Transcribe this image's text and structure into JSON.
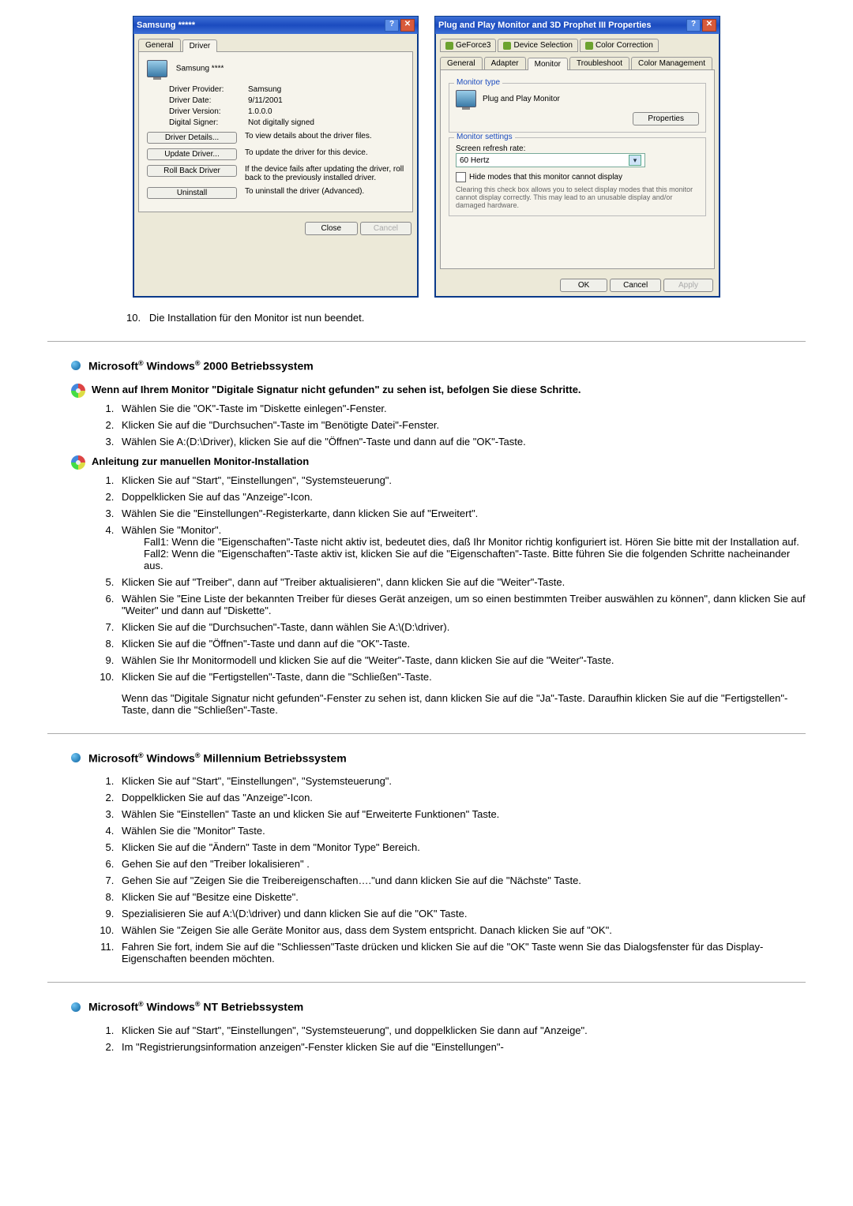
{
  "dialog_left": {
    "title": "Samsung *****",
    "tabs": {
      "general": "General",
      "driver": "Driver"
    },
    "device_name": "Samsung ****",
    "rows": {
      "provider_k": "Driver Provider:",
      "provider_v": "Samsung",
      "date_k": "Driver Date:",
      "date_v": "9/11/2001",
      "version_k": "Driver Version:",
      "version_v": "1.0.0.0",
      "signer_k": "Digital Signer:",
      "signer_v": "Not digitally signed"
    },
    "buttons": {
      "details": "Driver Details...",
      "details_desc": "To view details about the driver files.",
      "update": "Update Driver...",
      "update_desc": "To update the driver for this device.",
      "rollback": "Roll Back Driver",
      "rollback_desc": "If the device fails after updating the driver, roll back to the previously installed driver.",
      "uninstall": "Uninstall",
      "uninstall_desc": "To uninstall the driver (Advanced)."
    },
    "footer": {
      "close": "Close",
      "cancel": "Cancel"
    }
  },
  "dialog_right": {
    "title": "Plug and Play Monitor and 3D Prophet III Properties",
    "tabs_top": {
      "geforce": "GeForce3",
      "devsel": "Device Selection",
      "colorcorr": "Color Correction"
    },
    "tabs_bot": {
      "general": "General",
      "adapter": "Adapter",
      "monitor": "Monitor",
      "troubleshoot": "Troubleshoot",
      "colormgmt": "Color Management"
    },
    "group1": {
      "legend": "Monitor type",
      "name": "Plug and Play Monitor",
      "props": "Properties"
    },
    "group2": {
      "legend": "Monitor settings",
      "refresh_label": "Screen refresh rate:",
      "refresh_value": "60 Hertz",
      "hide_modes": "Hide modes that this monitor cannot display",
      "note": "Clearing this check box allows you to select display modes that this monitor cannot display correctly. This may lead to an unusable display and/or damaged hardware."
    },
    "footer": {
      "ok": "OK",
      "cancel": "Cancel",
      "apply": "Apply"
    }
  },
  "step10": "Die Installation für den Monitor ist nun beendet.",
  "sec2000": {
    "heading_pre": "Microsoft",
    "heading_mid": " Windows",
    "heading_post": " 2000 Betriebssystem",
    "sub1": "Wenn auf Ihrem Monitor \"Digitale Signatur nicht gefunden\" zu sehen ist, befolgen Sie diese Schritte.",
    "s1_1": "Wählen Sie die \"OK\"-Taste im \"Diskette einlegen\"-Fenster.",
    "s1_2": "Klicken Sie auf die \"Durchsuchen\"-Taste im \"Benötigte Datei\"-Fenster.",
    "s1_3": "Wählen Sie A:(D:\\Driver), klicken Sie auf die \"Öffnen\"-Taste und dann auf die \"OK\"-Taste.",
    "sub2": "Anleitung zur manuellen Monitor-Installation",
    "s2_1": "Klicken Sie auf \"Start\", \"Einstellungen\", \"Systemsteuerung\".",
    "s2_2": "Doppelklicken Sie auf das \"Anzeige\"-Icon.",
    "s2_3": "Wählen Sie die \"Einstellungen\"-Registerkarte, dann klicken Sie auf \"Erweitert\".",
    "s2_4": "Wählen Sie \"Monitor\".",
    "fall1": "Fall1: Wenn die \"Eigenschaften\"-Taste nicht aktiv ist, bedeutet dies, daß Ihr Monitor richtig konfiguriert ist. Hören Sie bitte mit der Installation auf.",
    "fall2": "Fall2: Wenn die \"Eigenschaften\"-Taste aktiv ist, klicken Sie auf die \"Eigenschaften\"-Taste. Bitte führen Sie die folgenden Schritte nacheinander aus.",
    "s2_5": "Klicken Sie auf \"Treiber\", dann auf \"Treiber aktualisieren\", dann klicken Sie auf die \"Weiter\"-Taste.",
    "s2_6": "Wählen Sie \"Eine Liste der bekannten Treiber für dieses Gerät anzeigen, um so einen bestimmten Treiber auswählen zu können\", dann klicken Sie auf \"Weiter\" und dann auf \"Diskette\".",
    "s2_7": "Klicken Sie auf die \"Durchsuchen\"-Taste, dann wählen Sie A:\\(D:\\driver).",
    "s2_8": "Klicken Sie auf die \"Öffnen\"-Taste und dann auf die \"OK\"-Taste.",
    "s2_9": "Wählen Sie Ihr Monitormodell und klicken Sie auf die \"Weiter\"-Taste, dann klicken Sie auf die \"Weiter\"-Taste.",
    "s2_10": "Klicken Sie auf die \"Fertigstellen\"-Taste, dann die \"Schließen\"-Taste.",
    "s2_tail": "Wenn das \"Digitale Signatur nicht gefunden\"-Fenster zu sehen ist, dann klicken Sie auf die \"Ja\"-Taste. Daraufhin klicken Sie auf die \"Fertigstellen\"-Taste, dann die \"Schließen\"-Taste."
  },
  "secME": {
    "heading_pre": "Microsoft",
    "heading_mid": " Windows",
    "heading_post": " Millennium Betriebssystem",
    "s1": "Klicken Sie auf \"Start\", \"Einstellungen\", \"Systemsteuerung\".",
    "s2": "Doppelklicken Sie auf das \"Anzeige\"-Icon.",
    "s3": "Wählen Sie \"Einstellen\" Taste an und klicken Sie auf \"Erweiterte Funktionen\" Taste.",
    "s4": "Wählen Sie die \"Monitor\" Taste.",
    "s5": "Klicken Sie auf die \"Ändern\" Taste in dem \"Monitor Type\" Bereich.",
    "s6": "Gehen Sie auf den \"Treiber lokalisieren\" .",
    "s7": "Gehen Sie auf \"Zeigen Sie die Treibereigenschaften….\"und dann klicken Sie auf die \"Nächste\" Taste.",
    "s8": "Klicken Sie auf \"Besitze eine Diskette\".",
    "s9": "Spezialisieren Sie auf A:\\(D:\\driver) und dann klicken Sie auf die \"OK\" Taste.",
    "s10": "Wählen Sie \"Zeigen Sie alle Geräte Monitor aus, dass dem System entspricht. Danach klicken Sie auf \"OK\".",
    "s11": "Fahren Sie fort, indem Sie auf die \"Schliessen\"Taste drücken und klicken Sie auf die \"OK\" Taste wenn Sie das Dialogsfenster für das Display-Eigenschaften beenden möchten."
  },
  "secNT": {
    "heading_pre": "Microsoft",
    "heading_mid": " Windows",
    "heading_post": " NT Betriebssystem",
    "s1": "Klicken Sie auf \"Start\", \"Einstellungen\", \"Systemsteuerung\", und doppelklicken Sie dann auf \"Anzeige\".",
    "s2": "Im \"Registrierungsinformation anzeigen\"-Fenster klicken Sie auf die \"Einstellungen\"-"
  }
}
